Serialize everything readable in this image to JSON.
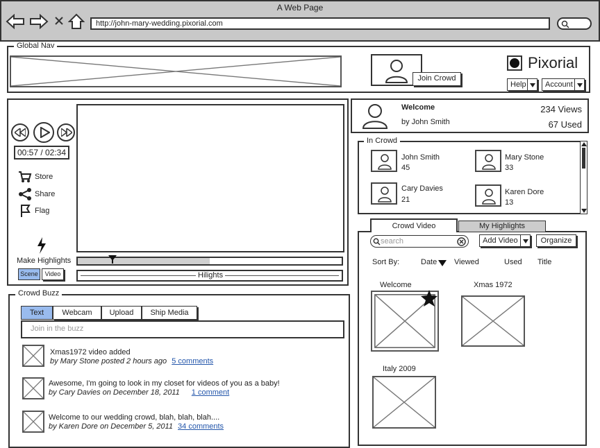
{
  "browser": {
    "title": "A Web Page",
    "url": "http://john-mary-wedding.pixorial.com"
  },
  "global_nav": {
    "legend": "Global Nav",
    "join_crowd": "Join Crowd",
    "brand": "Pixorial",
    "help": "Help",
    "account": "Account"
  },
  "player": {
    "time": "00:57 / 02:34",
    "actions": [
      "Store",
      "Share",
      "Flag"
    ],
    "make_highlights": "Make Highlights",
    "scene": "Scene",
    "video": "Video",
    "highlights_label": "Hilights",
    "progress": 0.5
  },
  "welcome": {
    "title": "Welcome",
    "by": "by John Smith",
    "views": "234 Views",
    "used": "67 Used"
  },
  "in_crowd": {
    "legend": "In Crowd",
    "members": [
      {
        "name": "John Smith",
        "count": "45"
      },
      {
        "name": "Mary Stone",
        "count": "33"
      },
      {
        "name": "Cary Davies",
        "count": "21"
      },
      {
        "name": "Karen Dore",
        "count": "13"
      }
    ]
  },
  "crowd_video": {
    "tabs": [
      "Crowd Video",
      "My Highlights"
    ],
    "search_placeholder": "search",
    "add_video": "Add Video",
    "organize": "Organize",
    "sort_by": "Sort By:",
    "sort_options": [
      "Date",
      "Viewed",
      "Used",
      "Title"
    ],
    "videos": [
      "Welcome",
      "Xmas 1972",
      "Italy 2009"
    ]
  },
  "crowd_buzz": {
    "legend": "Crowd Buzz",
    "tabs": [
      "Text",
      "Webcam",
      "Upload",
      "Ship Media"
    ],
    "input_placeholder": "Join in the buzz",
    "posts": [
      {
        "text": "Xmas1972 video added",
        "meta": "by Mary Stone posted 2 hours ago",
        "link": "5 comments"
      },
      {
        "text": "Awesome, I'm going to look in my closet for videos of you as a baby!",
        "meta": "by Cary Davies on December 18, 2011",
        "link": "1 comment"
      },
      {
        "text": "Welcome to our wedding crowd, blah, blah, blah....",
        "meta": "by Karen Dore on December 5, 2011",
        "link": "34 comments"
      }
    ]
  },
  "colors": {
    "accent": "#99bbee",
    "chrome": "#c8c8c8",
    "tab_inactive": "#cccccc"
  }
}
